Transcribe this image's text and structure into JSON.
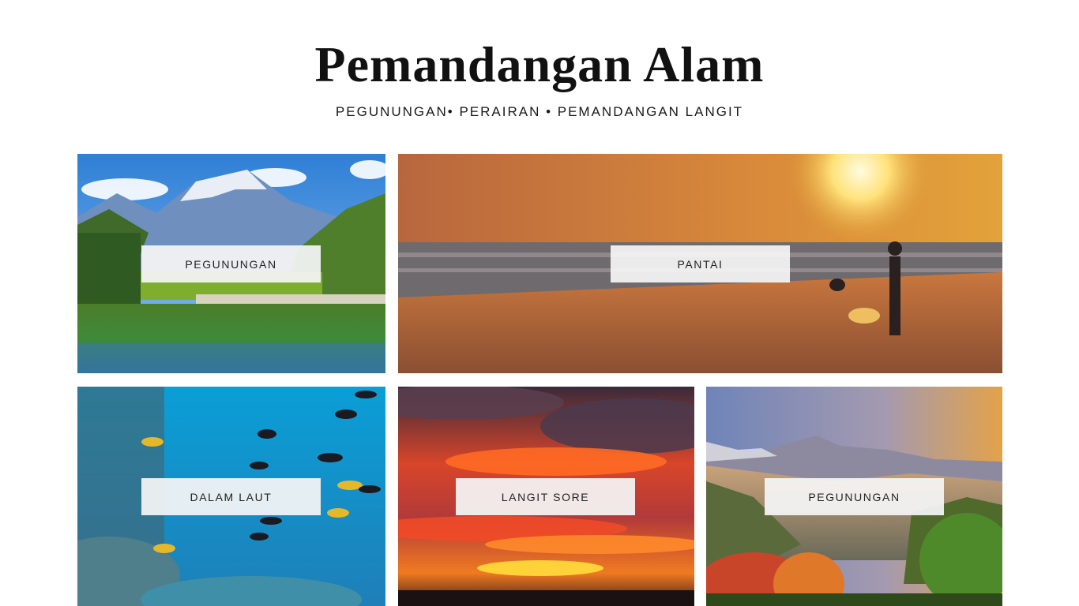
{
  "header": {
    "title": "Pemandangan Alam",
    "subtitle": "PEGUNUNGAN• PERAIRAN • PEMANDANGAN LANGIT"
  },
  "gallery": {
    "tiles": [
      {
        "label": "PEGUNUNGAN",
        "scene": "mountain-lake"
      },
      {
        "label": "PANTAI",
        "scene": "beach-sunset"
      },
      {
        "label": "DALAM LAUT",
        "scene": "underwater-reef"
      },
      {
        "label": "LANGIT SORE",
        "scene": "evening-sky"
      },
      {
        "label": "PEGUNUNGAN",
        "scene": "mountain-valley"
      }
    ]
  },
  "colors": {
    "title": "#111111",
    "label_background": "#f5f5f5",
    "page_background": "#ffffff"
  }
}
